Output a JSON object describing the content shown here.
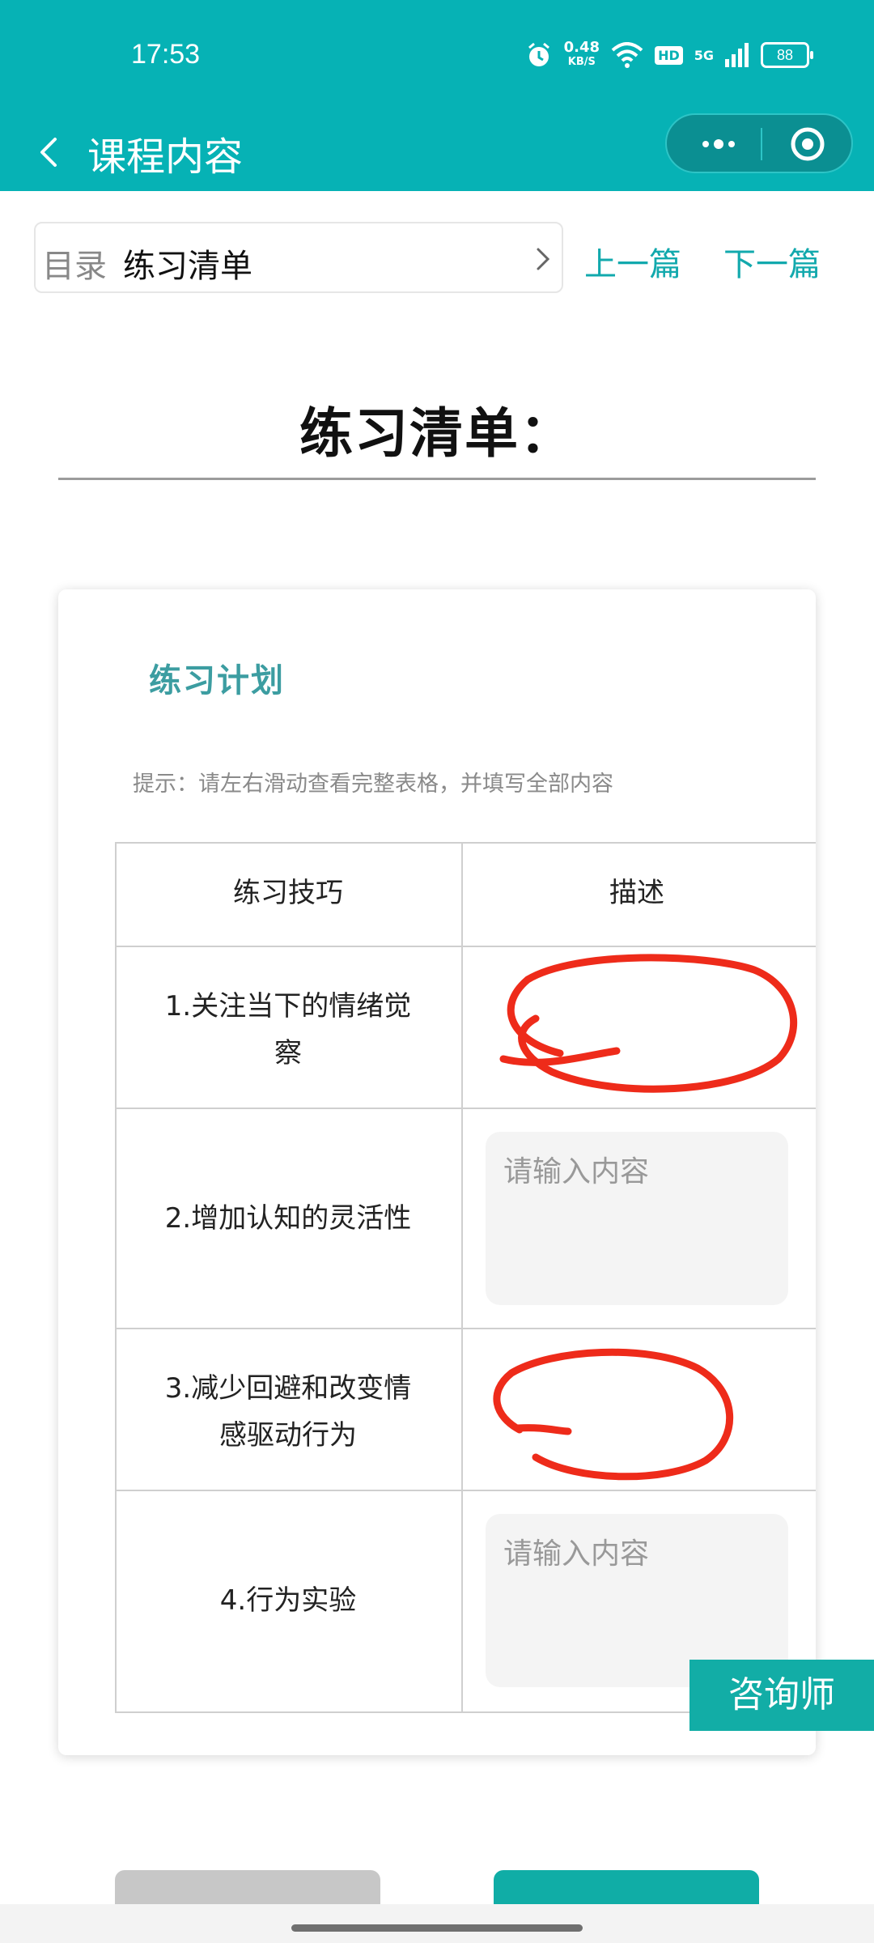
{
  "status_bar": {
    "time": "17:53",
    "net_speed_value": "0.48",
    "net_speed_unit": "KB/S",
    "hd_label": "HD",
    "network_label": "5G",
    "battery": "88"
  },
  "title_bar": {
    "title": "课程内容"
  },
  "directory": {
    "label": "目录",
    "current": "练习清单",
    "prev_label": "上一篇",
    "next_label": "下一篇"
  },
  "main": {
    "heading": "练习清单："
  },
  "card": {
    "title": "练习计划",
    "tip": "提示：请左右滑动查看完整表格，并填写全部内容",
    "table": {
      "headers": [
        "练习技巧",
        "描述"
      ],
      "rows": [
        {
          "skill_line1": "1.关注当下的情绪觉",
          "skill_line2": "察"
        },
        {
          "skill_line1": "2.增加认知的灵活性",
          "placeholder": "请输入内容"
        },
        {
          "skill_line1": "3.减少回避和改变情",
          "skill_line2": "感驱动行为"
        },
        {
          "skill_line1": "4.行为实验",
          "placeholder": "请输入内容"
        }
      ]
    }
  },
  "floating": {
    "consult_label": "咨询师"
  },
  "colors": {
    "brand": "#06b2b5",
    "link": "#12a9ad",
    "card_title": "#3c9da1",
    "annotation": "#ee2b1a"
  }
}
